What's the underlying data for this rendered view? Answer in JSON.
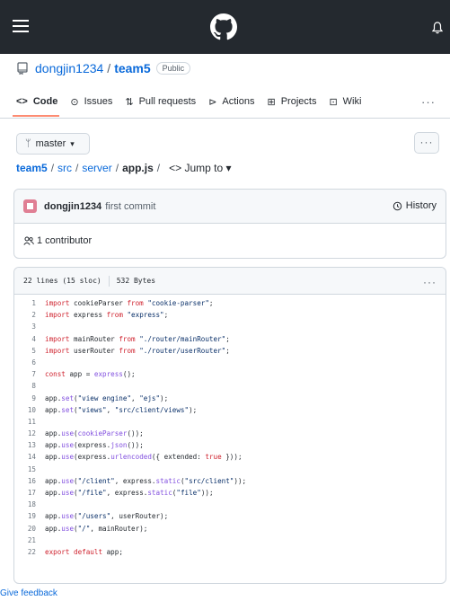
{
  "header": {
    "menu_icon": "hamburger-icon",
    "logo_icon": "github-logo-icon",
    "notification_icon": "bell-icon"
  },
  "repo": {
    "icon": "repo-icon",
    "owner": "dongjin1234",
    "separator": "/",
    "name": "team5",
    "visibility": "Public"
  },
  "tabs": [
    {
      "label": "Code",
      "icon": "code-icon",
      "glyph": "<>",
      "active": true
    },
    {
      "label": "Issues",
      "icon": "issue-icon",
      "glyph": "⊙"
    },
    {
      "label": "Pull requests",
      "icon": "pull-request-icon",
      "glyph": "⇅"
    },
    {
      "label": "Actions",
      "icon": "play-icon",
      "glyph": "⊳"
    },
    {
      "label": "Projects",
      "icon": "table-icon",
      "glyph": "⊞"
    },
    {
      "label": "Wiki",
      "icon": "book-icon",
      "glyph": "⊡"
    }
  ],
  "tabs_more": "···",
  "branch": {
    "name": "master",
    "icon": "git-branch-icon",
    "glyph": "ᛘ",
    "caret": "▾"
  },
  "more_button": "···",
  "breadcrumb": {
    "repo": "team5",
    "sep": "/",
    "dirs": [
      "src",
      "server"
    ],
    "file": "app.js",
    "jump": "<> Jump to ▾"
  },
  "commit": {
    "author": "dongjin1234",
    "message": "first commit",
    "history_label": "History",
    "history_icon": "history-icon"
  },
  "contributors": {
    "icon": "people-icon",
    "text": "1 contributor"
  },
  "file": {
    "lines_info": "22 lines (15 sloc)",
    "size": "532 Bytes",
    "more": "···",
    "code": [
      {
        "n": "1",
        "t": "import cookieParser from \"cookie-parser\";"
      },
      {
        "n": "2",
        "t": "import express from \"express\";"
      },
      {
        "n": "3",
        "t": ""
      },
      {
        "n": "4",
        "t": "import mainRouter from \"./router/mainRouter\";"
      },
      {
        "n": "5",
        "t": "import userRouter from \"./router/userRouter\";"
      },
      {
        "n": "6",
        "t": ""
      },
      {
        "n": "7",
        "t": "const app = express();"
      },
      {
        "n": "8",
        "t": ""
      },
      {
        "n": "9",
        "t": "app.set(\"view engine\", \"ejs\");"
      },
      {
        "n": "10",
        "t": "app.set(\"views\", \"src/client/views\");"
      },
      {
        "n": "11",
        "t": ""
      },
      {
        "n": "12",
        "t": "app.use(cookieParser());"
      },
      {
        "n": "13",
        "t": "app.use(express.json());"
      },
      {
        "n": "14",
        "t": "app.use(express.urlencoded({ extended: true }));"
      },
      {
        "n": "15",
        "t": ""
      },
      {
        "n": "16",
        "t": "app.use(\"/client\", express.static(\"src/client\"));"
      },
      {
        "n": "17",
        "t": "app.use(\"/file\", express.static(\"file\"));"
      },
      {
        "n": "18",
        "t": ""
      },
      {
        "n": "19",
        "t": "app.use(\"/users\", userRouter);"
      },
      {
        "n": "20",
        "t": "app.use(\"/\", mainRouter);"
      },
      {
        "n": "21",
        "t": ""
      },
      {
        "n": "22",
        "t": "export default app;"
      }
    ]
  },
  "feedback": "Give feedback",
  "colors": {
    "header_bg": "#24292f",
    "link": "#0969da",
    "keyword": "#cf222e",
    "string": "#0a3069",
    "function": "#8250df",
    "active_tab_underline": "#fd8c73"
  }
}
